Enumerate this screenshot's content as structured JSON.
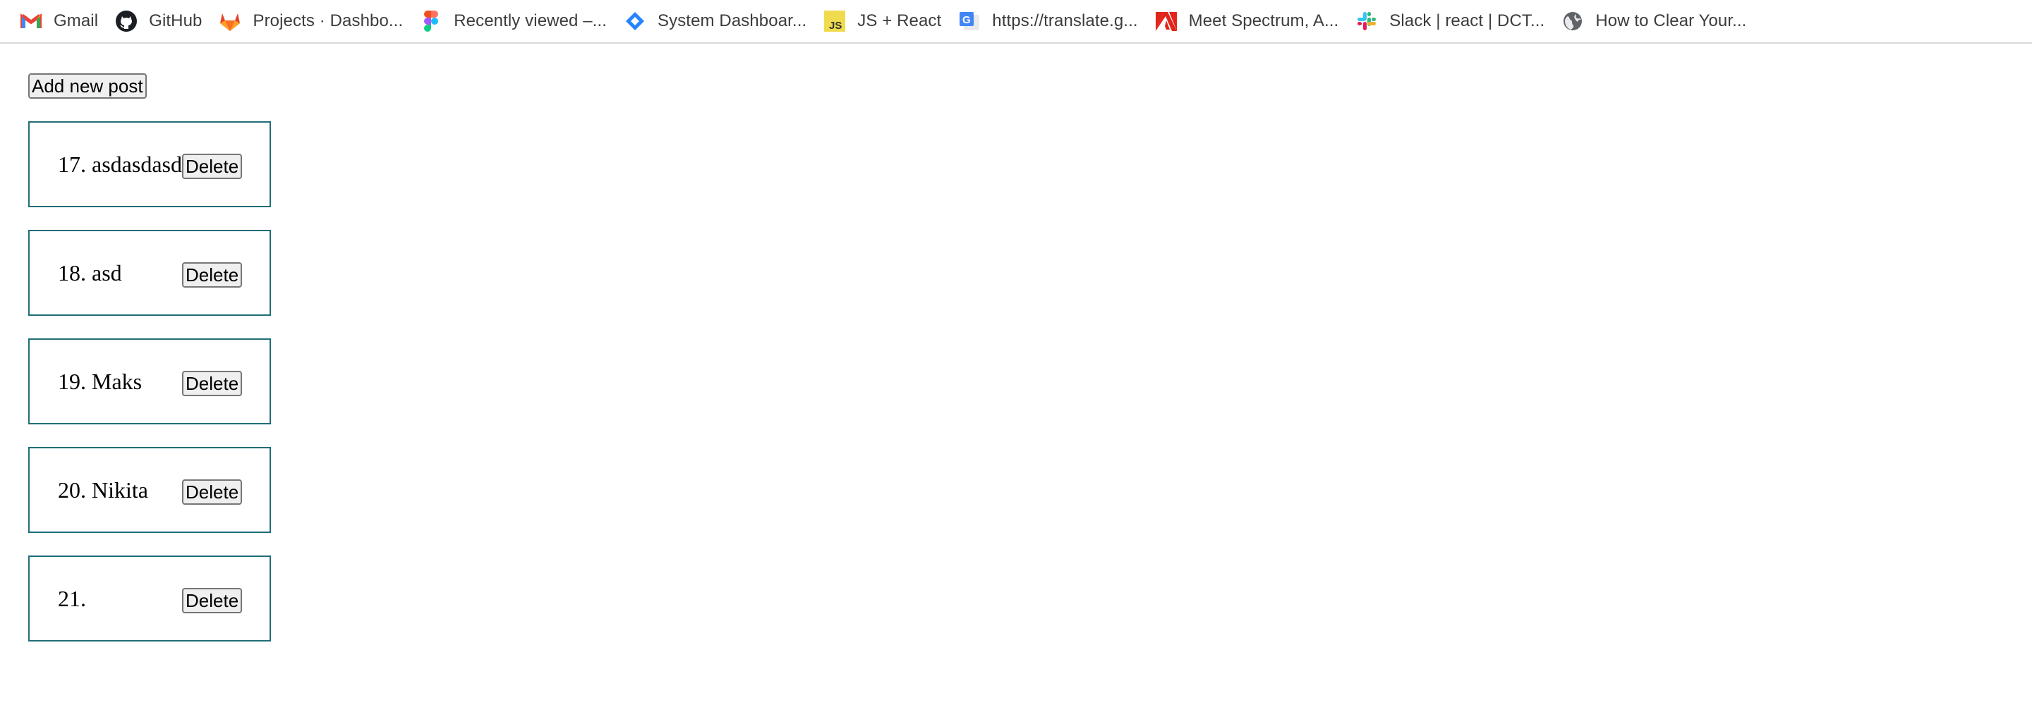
{
  "bookmarks": [
    {
      "label": "Gmail",
      "icon": "gmail-icon"
    },
    {
      "label": "GitHub",
      "icon": "github-icon"
    },
    {
      "label": "Projects · Dashbo...",
      "icon": "gitlab-icon"
    },
    {
      "label": "Recently viewed –...",
      "icon": "figma-icon"
    },
    {
      "label": "System Dashboar...",
      "icon": "jira-icon"
    },
    {
      "label": "JS + React",
      "icon": "js-icon"
    },
    {
      "label": "https://translate.g...",
      "icon": "google-translate-icon"
    },
    {
      "label": "Meet Spectrum, A...",
      "icon": "adobe-icon"
    },
    {
      "label": "Slack | react | DCT...",
      "icon": "slack-icon"
    },
    {
      "label": "How to Clear Your...",
      "icon": "globe-icon"
    }
  ],
  "icon_text": {
    "js": "JS",
    "translate": "G"
  },
  "page": {
    "add_button_label": "Add new post"
  },
  "posts": [
    {
      "number": "17.",
      "title": "asdasdasd",
      "delete_label": "Delete"
    },
    {
      "number": "18.",
      "title": "asd",
      "delete_label": "Delete"
    },
    {
      "number": "19.",
      "title": "Maks",
      "delete_label": "Delete"
    },
    {
      "number": "20.",
      "title": "Nikita",
      "delete_label": "Delete"
    },
    {
      "number": "21.",
      "title": "",
      "delete_label": "Delete"
    }
  ],
  "colors": {
    "card_border": "#1f6e78",
    "bookmark_text": "#3c3c3c",
    "button_background": "#efefef"
  }
}
